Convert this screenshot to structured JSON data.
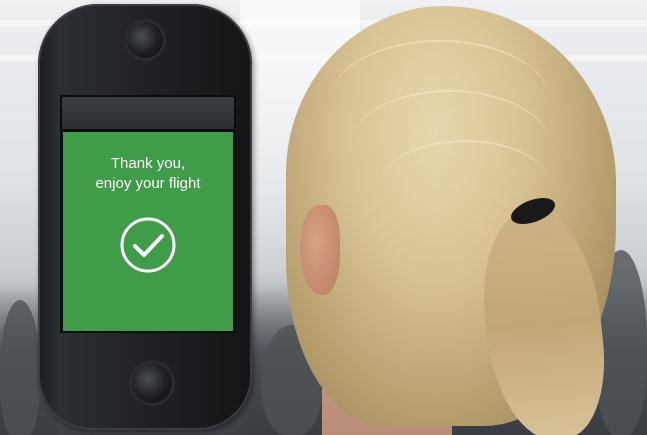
{
  "scene": {
    "kiosk": {
      "screen_message_line1": "Thank you,",
      "screen_message_line2": "enjoy your flight",
      "screen_color": "#3f9c48",
      "status_icon": "checkmark-circle-icon"
    }
  }
}
